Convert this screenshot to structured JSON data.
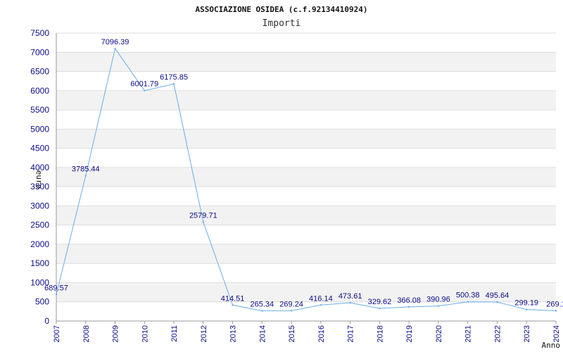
{
  "chart_data": {
    "type": "line",
    "title": "ASSOCIAZIONE OSIDEA (c.f.92134410924)",
    "subtitle": "Importi",
    "xlabel": "Anno",
    "ylabel": "euro",
    "ylim": [
      0,
      7500
    ],
    "yticks": [
      0,
      500,
      1000,
      1500,
      2000,
      2500,
      3000,
      3500,
      4000,
      4500,
      5000,
      5500,
      6000,
      6500,
      7000,
      7500
    ],
    "x": [
      "2007",
      "2008",
      "2009",
      "2010",
      "2011",
      "2012",
      "2013",
      "2014",
      "2015",
      "2016",
      "2017",
      "2018",
      "2019",
      "2020",
      "2021",
      "2022",
      "2023",
      "2024"
    ],
    "series": [
      {
        "values": [
          689.57,
          3785.44,
          7096.39,
          6001.79,
          6175.85,
          2579.71,
          414.51,
          265.34,
          269.24,
          416.14,
          473.61,
          329.62,
          366.08,
          390.96,
          500.38,
          495.64,
          299.19,
          269.1
        ],
        "labels": [
          "689.57",
          "3785.44",
          "7096.39",
          "6001.79",
          "6175.85",
          "2579.71",
          "414.51",
          "265.34",
          "269.24",
          "416.14",
          "473.61",
          "329.62",
          "366.08",
          "390.96",
          "500.38",
          "495.64",
          "299.19",
          "269.1"
        ]
      }
    ],
    "grid": true,
    "colors": {
      "line": "#6aaee8",
      "band": "#f2f2f2",
      "text": "#0b0b8a",
      "grid": "#dddddd"
    }
  }
}
